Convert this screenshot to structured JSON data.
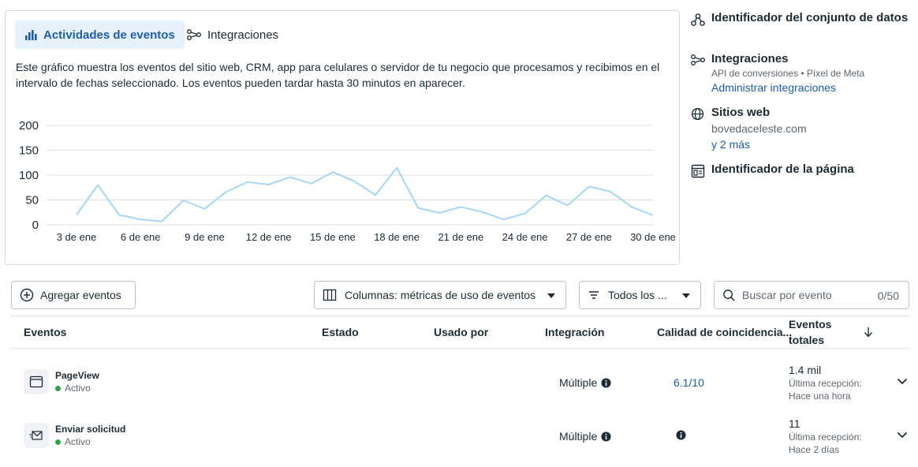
{
  "tabs": [
    {
      "label": "Actividades de eventos",
      "active": true,
      "icon": "bar-chart-icon"
    },
    {
      "label": "Integraciones",
      "active": false,
      "icon": "integrations-icon"
    }
  ],
  "chart_description": "Este gráfico muestra los eventos del sitio web, CRM, app para celulares o servidor de tu negocio que procesamos y recibimos en el intervalo de fechas seleccionado. Los eventos pueden tardar hasta 30 minutos en aparecer.",
  "chart_data": {
    "type": "line",
    "title": "",
    "xlabel": "",
    "ylabel": "",
    "ylim": [
      0,
      200
    ],
    "yticks": [
      0,
      50,
      100,
      150,
      200
    ],
    "xticks": [
      "3 de ene",
      "6 de ene",
      "9 de ene",
      "12 de ene",
      "15 de ene",
      "18 de ene",
      "21 de ene",
      "24 de ene",
      "27 de ene",
      "30 de ene"
    ],
    "grid": true,
    "line_color": "#a7d6f0",
    "series": [
      {
        "name": "",
        "x": [
          "3 de ene",
          "4 de ene",
          "5 de ene",
          "6 de ene",
          "7 de ene",
          "8 de ene",
          "9 de ene",
          "10 de ene",
          "11 de ene",
          "12 de ene",
          "13 de ene",
          "14 de ene",
          "15 de ene",
          "16 de ene",
          "17 de ene",
          "18 de ene",
          "19 de ene",
          "20 de ene",
          "21 de ene",
          "22 de ene",
          "23 de ene",
          "24 de ene",
          "25 de ene",
          "26 de ene",
          "27 de ene",
          "28 de ene",
          "29 de ene",
          "30 de ene"
        ],
        "values": [
          20,
          80,
          20,
          11,
          7,
          49,
          32,
          66,
          86,
          81,
          96,
          83,
          106,
          88,
          60,
          115,
          34,
          24,
          36,
          26,
          11,
          23,
          59,
          39,
          77,
          67,
          36,
          19
        ]
      }
    ]
  },
  "right_panel": {
    "dataset_id_title": "Identificador del conjunto de datos",
    "integrations_title": "Integraciones",
    "integrations_sub": "API de conversiones • Píxel de Meta",
    "integrations_link": "Administrar integraciones",
    "websites_title": "Sitios web",
    "websites_domain": "bovedaceleste.com",
    "websites_more": "y 2 más",
    "page_id_title": "Identificador de la página"
  },
  "toolbar": {
    "add_events": "Agregar eventos",
    "columns": "Columnas: métricas de uso de eventos",
    "filter": "Todos los ...",
    "search_placeholder": "Buscar por evento",
    "search_count": "0/50"
  },
  "table": {
    "headers": {
      "events": "Eventos",
      "status": "Estado",
      "used_by": "Usado por",
      "integration": "Integración",
      "quality": "Calidad de coincidencia...",
      "total_line1": "Eventos",
      "total_line2": "totales"
    },
    "rows": [
      {
        "name": "PageView",
        "status": "Activo",
        "integration": "Múltiple",
        "quality": "6.1/10",
        "total": "1.4 mil",
        "last_label": "Última recepción:",
        "last_value": "Hace una hora"
      },
      {
        "name": "Enviar solicitud",
        "status": "Activo",
        "integration": "Múltiple",
        "quality": "",
        "total": "11",
        "last_label": "Última recepción:",
        "last_value": "Hace 2 días"
      }
    ]
  },
  "colors": {
    "accent": "#1d5fa7",
    "active_tab_bg": "#e7f1fb",
    "status_active": "#31a24c"
  }
}
